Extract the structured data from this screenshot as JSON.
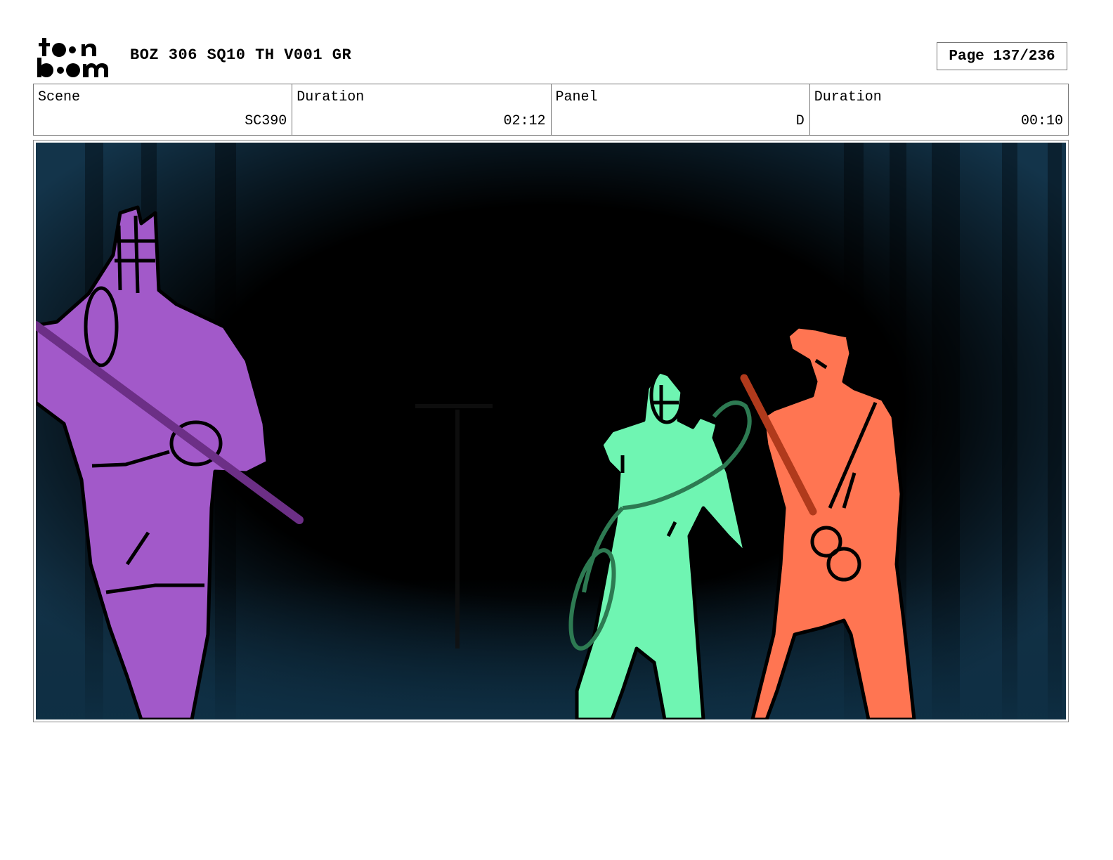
{
  "header": {
    "logo_text": "toon boom",
    "project_title": "BOZ 306 SQ10 TH V001 GR",
    "page_label": "Page 137/236"
  },
  "info": {
    "scene_label": "Scene",
    "scene_value": "SC390",
    "scene_duration_label": "Duration",
    "scene_duration_value": "02:12",
    "panel_label": "Panel",
    "panel_value": "D",
    "panel_duration_label": "Duration",
    "panel_duration_value": "00:10"
  },
  "colors": {
    "figure_left": "#a259c9",
    "figure_center": "#6ff5b2",
    "figure_right": "#ff7552",
    "background_dark": "#000000",
    "background_forest": "#13344a"
  }
}
